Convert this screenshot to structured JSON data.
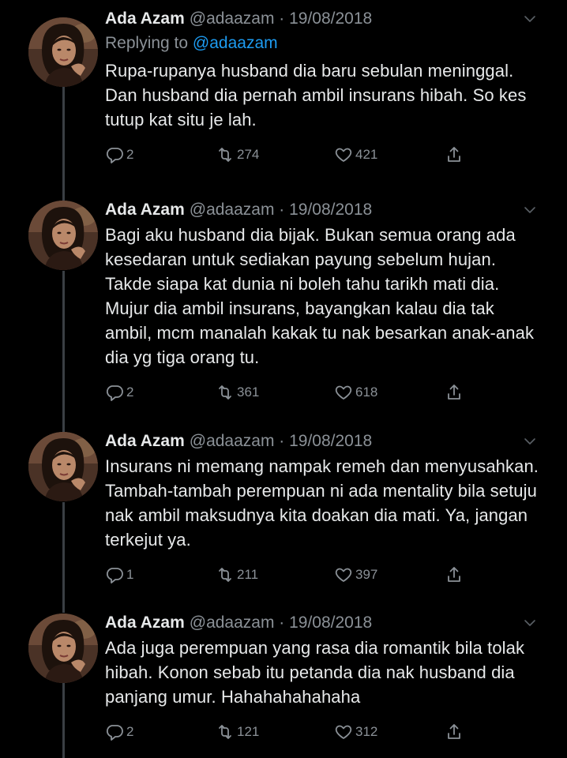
{
  "tweets": [
    {
      "name": "Ada Azam",
      "meta": "@adaazam · 19/08/2018",
      "reply_prefix": "Replying to",
      "reply_handle": "@adaazam",
      "text": "Rupa-rupanya husband dia baru sebulan meninggal. Dan husband dia pernah ambil insurans hibah. So kes tutup kat situ je lah.",
      "replies": "2",
      "retweets": "274",
      "likes": "421"
    },
    {
      "name": "Ada Azam",
      "meta": "@adaazam · 19/08/2018",
      "text": "Bagi aku husband dia bijak. Bukan semua orang ada kesedaran untuk sediakan payung sebelum hujan. Takde siapa kat dunia ni boleh tahu tarikh mati dia. Mujur dia ambil insurans, bayangkan kalau dia tak ambil, mcm manalah kakak tu nak besarkan anak-anak dia yg tiga orang tu.",
      "replies": "2",
      "retweets": "361",
      "likes": "618"
    },
    {
      "name": "Ada Azam",
      "meta": "@adaazam · 19/08/2018",
      "text": "Insurans ni memang nampak remeh dan menyusahkan. Tambah-tambah perempuan ni ada mentality bila setuju nak ambil maksudnya kita doakan dia mati. Ya, jangan terkejut ya.",
      "replies": "1",
      "retweets": "211",
      "likes": "397"
    },
    {
      "name": "Ada Azam",
      "meta": "@adaazam · 19/08/2018",
      "text": "Ada juga perempuan yang rasa dia romantik bila tolak hibah. Konon sebab itu petanda dia nak husband dia panjang umur. Hahahahahahaha",
      "replies": "2",
      "retweets": "121",
      "likes": "312"
    }
  ],
  "colors": {
    "background": "#000000",
    "text": "#e7e9ea",
    "muted": "#8b9197",
    "link": "#1d9bf0",
    "thread_line": "#3a3f44"
  },
  "icons": [
    "reply-icon",
    "retweet-icon",
    "like-icon",
    "share-icon",
    "caret-down-icon"
  ]
}
